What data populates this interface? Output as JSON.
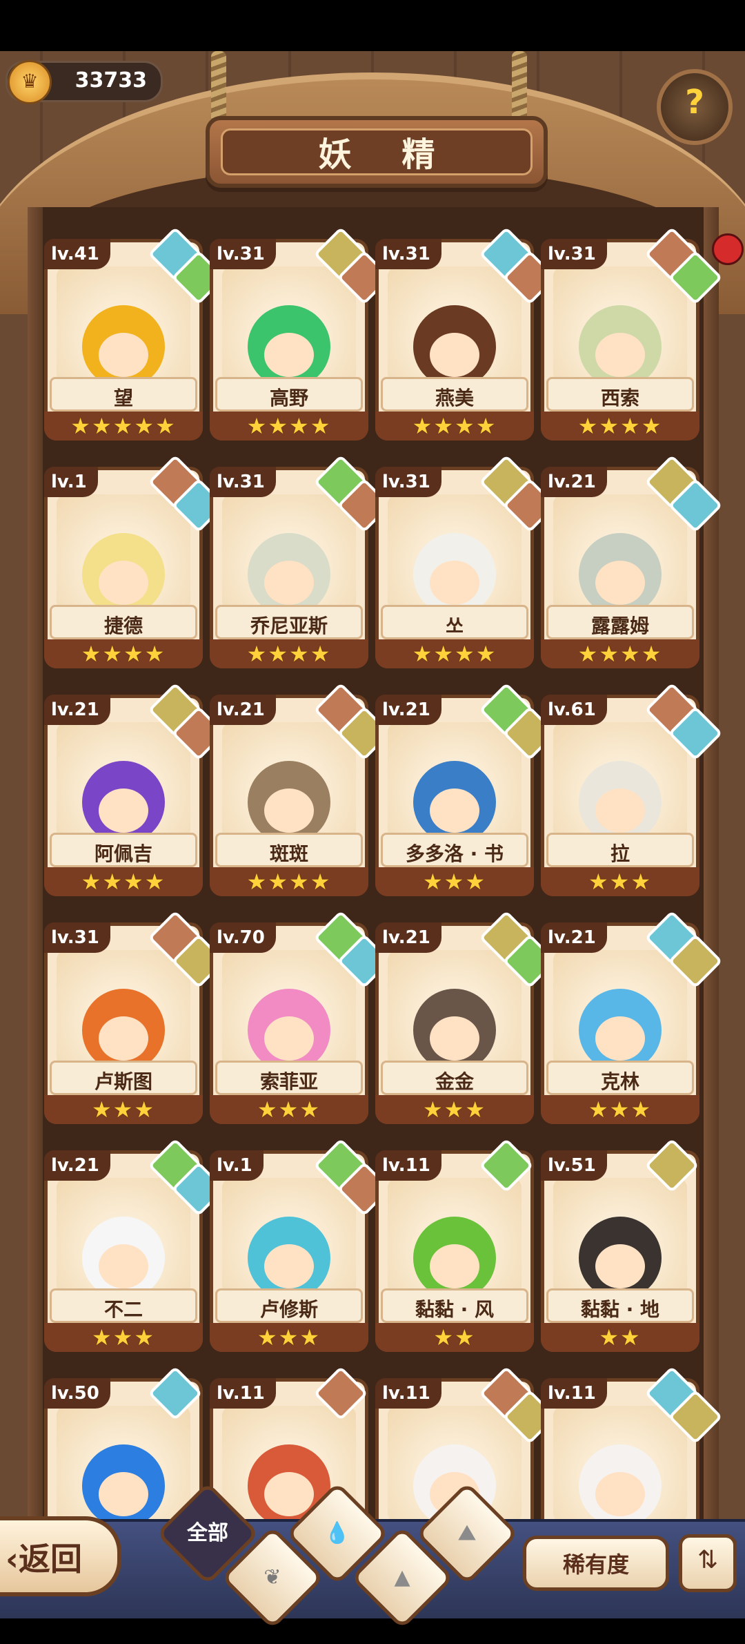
{
  "header": {
    "title": "妖 精",
    "coins": "33733",
    "help_icon": "sprout-question-icon"
  },
  "elements": {
    "water": "#6cc6d6",
    "grass": "#7dc95c",
    "earth": "#c9b45e",
    "fire": "#c07a56"
  },
  "cards": [
    {
      "level": "lv.41",
      "name": "望",
      "stars": "★★★★★",
      "elements": [
        "water",
        "grass"
      ],
      "hair": "#f2b21d"
    },
    {
      "level": "lv.31",
      "name": "高野",
      "stars": "★★★★",
      "elements": [
        "earth",
        "fire"
      ],
      "hair": "#3cc46d"
    },
    {
      "level": "lv.31",
      "name": "燕美",
      "stars": "★★★★",
      "elements": [
        "water",
        "fire"
      ],
      "hair": "#6b3a22"
    },
    {
      "level": "lv.31",
      "name": "西索",
      "stars": "★★★★",
      "elements": [
        "fire",
        "grass"
      ],
      "hair": "#cfd9a8"
    },
    {
      "level": "lv.1",
      "name": "捷德",
      "stars": "★★★★",
      "elements": [
        "fire",
        "water"
      ],
      "hair": "#f4e08a"
    },
    {
      "level": "lv.31",
      "name": "乔尼亚斯",
      "stars": "★★★★",
      "elements": [
        "grass",
        "fire"
      ],
      "hair": "#d8dcc8"
    },
    {
      "level": "lv.31",
      "name": "쏘",
      "stars": "★★★★",
      "elements": [
        "earth",
        "fire"
      ],
      "hair": "#f2f0ea"
    },
    {
      "level": "lv.21",
      "name": "露露姆",
      "stars": "★★★★",
      "elements": [
        "earth",
        "water"
      ],
      "hair": "#c6cfc2"
    },
    {
      "level": "lv.21",
      "name": "阿佩吉",
      "stars": "★★★★",
      "elements": [
        "earth",
        "fire"
      ],
      "hair": "#7b45c8"
    },
    {
      "level": "lv.21",
      "name": "斑斑",
      "stars": "★★★★",
      "elements": [
        "fire",
        "earth"
      ],
      "hair": "#9a8060"
    },
    {
      "level": "lv.21",
      "name": "多多洛 · 书",
      "stars": "★★★",
      "elements": [
        "grass",
        "earth"
      ],
      "hair": "#3a7ec8"
    },
    {
      "level": "lv.61",
      "name": "拉",
      "stars": "★★★",
      "elements": [
        "fire",
        "water"
      ],
      "hair": "#eae6dc"
    },
    {
      "level": "lv.31",
      "name": "卢斯图",
      "stars": "★★★",
      "elements": [
        "fire",
        "earth"
      ],
      "hair": "#e8722a"
    },
    {
      "level": "lv.70",
      "name": "索菲亚",
      "stars": "★★★",
      "elements": [
        "grass",
        "water"
      ],
      "hair": "#f28ac4"
    },
    {
      "level": "lv.21",
      "name": "金金",
      "stars": "★★★",
      "elements": [
        "earth",
        "grass"
      ],
      "hair": "#6a5648"
    },
    {
      "level": "lv.21",
      "name": "克林",
      "stars": "★★★",
      "elements": [
        "water",
        "earth"
      ],
      "hair": "#59b7e8"
    },
    {
      "level": "lv.21",
      "name": "不二",
      "stars": "★★★",
      "elements": [
        "grass",
        "water"
      ],
      "hair": "#f6f6f6"
    },
    {
      "level": "lv.1",
      "name": "卢修斯",
      "stars": "★★★",
      "elements": [
        "grass",
        "fire"
      ],
      "hair": "#4fc2d8"
    },
    {
      "level": "lv.11",
      "name": "黏黏 · 风",
      "stars": "★★",
      "elements": [
        "grass"
      ],
      "hair": "#6ac23a"
    },
    {
      "level": "lv.51",
      "name": "黏黏 · 地",
      "stars": "★★",
      "elements": [
        "earth"
      ],
      "hair": "#3a3330"
    },
    {
      "level": "lv.50",
      "name": "",
      "stars": "",
      "elements": [
        "water"
      ],
      "hair": "#2c7ee0"
    },
    {
      "level": "lv.11",
      "name": "",
      "stars": "",
      "elements": [
        "fire"
      ],
      "hair": "#d85a38"
    },
    {
      "level": "lv.11",
      "name": "",
      "stars": "",
      "elements": [
        "fire",
        "earth"
      ],
      "hair": "#f6f2f0"
    },
    {
      "level": "lv.11",
      "name": "",
      "stars": "",
      "elements": [
        "water",
        "earth"
      ],
      "hair": "#f6f2f0"
    }
  ],
  "bottom": {
    "back_label": "‹返回",
    "filter_all": "全部",
    "filters": [
      "grass-icon",
      "water-icon",
      "earth-icon",
      "fire-icon"
    ],
    "rarity_label": "稀有度",
    "sort_icon": "sort-icon"
  }
}
